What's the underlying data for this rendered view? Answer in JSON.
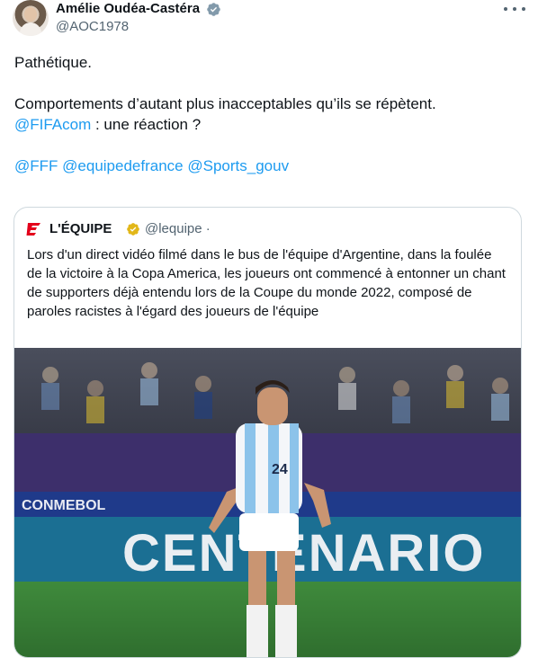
{
  "author": {
    "name": "Amélie Oudéa-Castéra",
    "handle": "@AOC1978",
    "verified_color": "#829aab"
  },
  "tweet": {
    "line1": "Pathétique.",
    "line2": "Comportements d’autant plus inacceptables qu’ils se répètent.",
    "mention_fifa": "@FIFAcom",
    "line3_rest": " : une réaction ?",
    "mention_fff": "@FFF",
    "mention_edf": "@equipedefrance",
    "mention_sports": "@Sports_gouv"
  },
  "quote": {
    "name": "L'ÉQUIPE",
    "handle": "@lequipe ·",
    "verified_color": "#e2b719",
    "text": "Lors d'un direct vidéo filmé dans le bus de l'équipe d'Argentine, dans la foulée de la victoire à la Copa America, les joueurs ont commencé à entonner un chant de supporters déjà entendu lors de la Coupe du monde 2022, composé de paroles racistes à l'égard des joueurs de l'équipe",
    "image": {
      "board_text": "CENTENARIO",
      "shirt_number": "24",
      "banner_text": "CONMEBOL"
    }
  },
  "colors": {
    "link": "#1d9bf0",
    "text": "#0f1419",
    "muted": "#536471",
    "border": "#cfd9de",
    "logo_red": "#e3001b"
  }
}
